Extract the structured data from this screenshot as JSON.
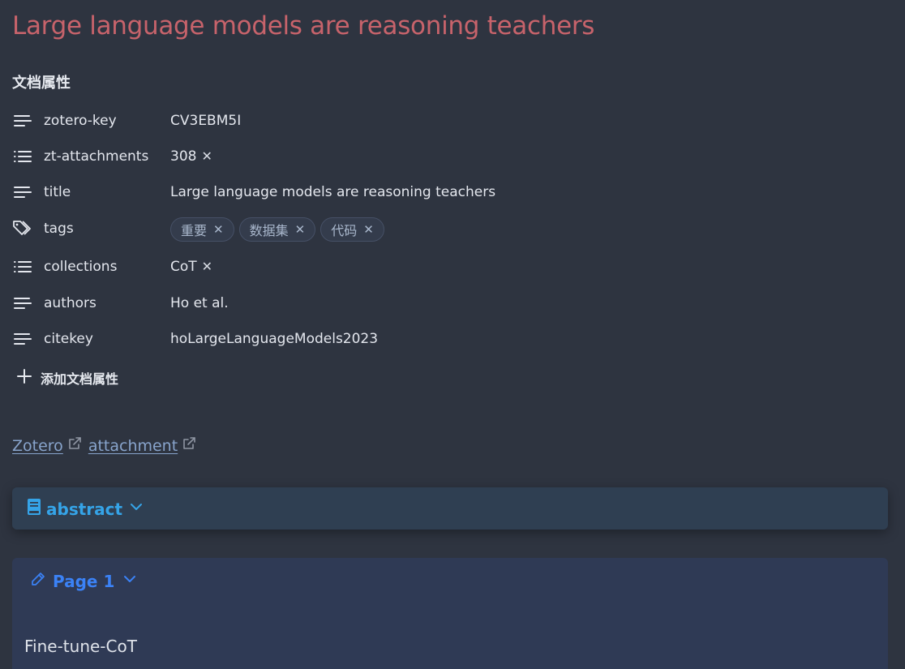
{
  "title": "Large language models are reasoning teachers",
  "properties": {
    "heading": "文档属性",
    "rows": [
      {
        "key": "zotero-key",
        "value": "CV3EBM5I",
        "icon": "text-lines-icon"
      },
      {
        "key": "zt-attachments",
        "value": "308",
        "icon": "list-icon"
      },
      {
        "key": "title",
        "value": "Large language models are reasoning teachers",
        "icon": "text-lines-icon"
      },
      {
        "key": "tags",
        "icon": "tags-icon",
        "tags": [
          "重要",
          "数据集",
          "代码"
        ]
      },
      {
        "key": "collections",
        "value": "CoT",
        "icon": "list-icon"
      },
      {
        "key": "authors",
        "value": "Ho et al.",
        "icon": "text-lines-icon"
      },
      {
        "key": "citekey",
        "value": "hoLargeLanguageModels2023",
        "icon": "text-lines-icon"
      }
    ],
    "add_label": "添加文档属性"
  },
  "links": {
    "zotero": "Zotero",
    "attachment": "attachment"
  },
  "abstract_callout": {
    "title": "abstract"
  },
  "page_callout": {
    "title": "Page 1",
    "body": "Fine-tune-CoT"
  },
  "colors": {
    "background": "#2e3440",
    "title": "#c7636b",
    "link": "#88a4cc",
    "abstract_accent": "#35a4e8",
    "page_accent": "#3b82f6",
    "tag_text": "#a9b7cc"
  }
}
